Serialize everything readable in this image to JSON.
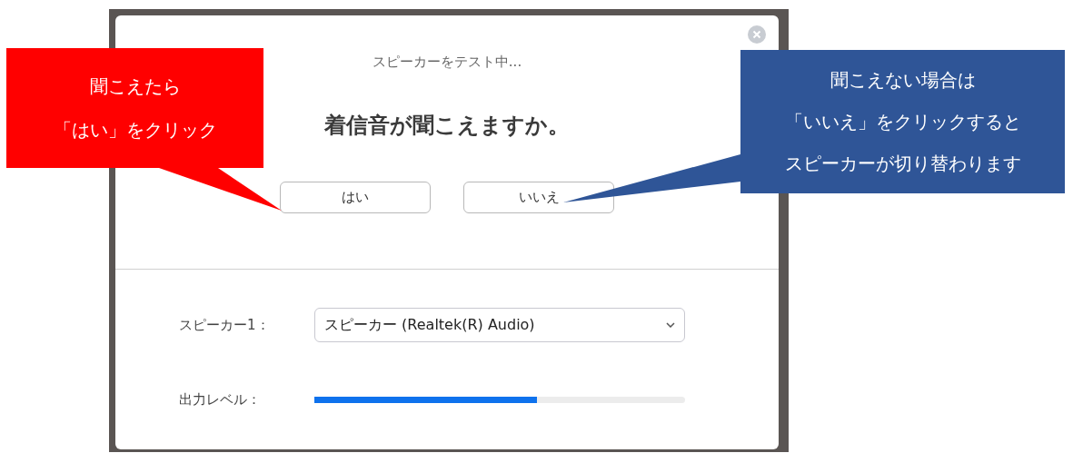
{
  "dialog": {
    "title": "スピーカーをテスト中...",
    "question": "着信音が聞こえますか。",
    "buttons": [
      "はい",
      "いいえ"
    ],
    "speaker": {
      "label": "スピーカー1：",
      "value": "スピーカー (Realtek(R) Audio)"
    },
    "output_level": {
      "label": "出力レベル：",
      "level": 0.6
    }
  },
  "callouts": [
    {
      "color": "#ff0000",
      "lines": [
        "聞こえたら",
        "「はい」をクリック"
      ]
    },
    {
      "color": "#2f5597",
      "lines": [
        "聞こえない場合は",
        "「いいえ」をクリックすると",
        "スピーカーが切り替わります"
      ]
    }
  ]
}
